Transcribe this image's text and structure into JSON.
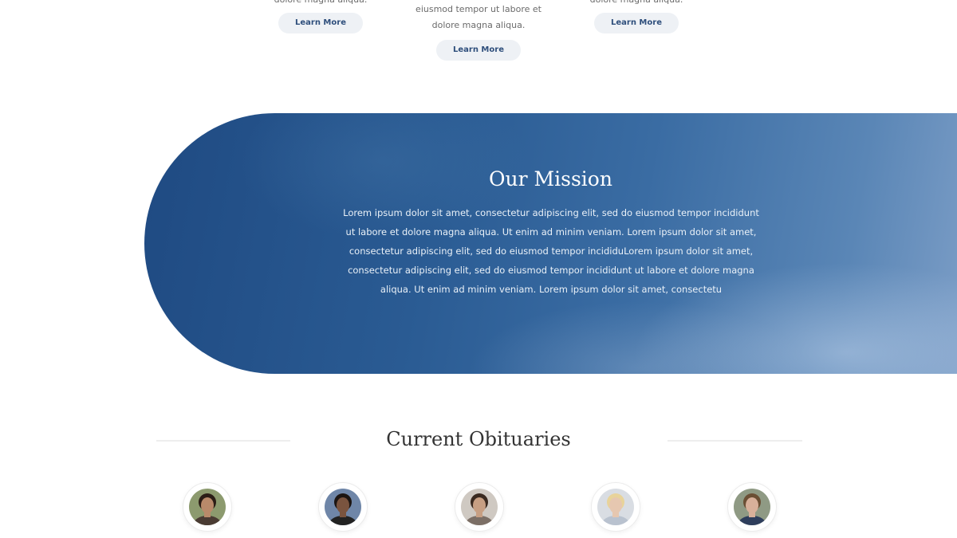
{
  "services": [
    {
      "desc_lines": [
        "dolore magna aliqua."
      ],
      "button_label": "Learn More"
    },
    {
      "desc_lines": [
        "eiusmod tempor ut labore et",
        "dolore magna aliqua."
      ],
      "button_label": "Learn More"
    },
    {
      "desc_lines": [
        "dolore magna aliqua."
      ],
      "button_label": "Learn More"
    }
  ],
  "mission": {
    "title": "Our Mission",
    "text": "Lorem ipsum dolor sit amet, consectetur adipiscing elit, sed do eiusmod tempor incididunt ut labore et dolore magna aliqua. Ut enim ad minim veniam. Lorem ipsum dolor sit amet, consectetur adipiscing elit, sed do eiusmod tempor incididuLorem ipsum dolor sit amet, consectetur adipiscing elit, sed do eiusmod tempor incididunt ut labore et dolore magna aliqua. Ut enim ad minim veniam. Lorem ipsum dolor sit amet, consectetu"
  },
  "obituaries": {
    "title": "Current Obituaries",
    "avatars": [
      {
        "skin": "#b98a6a",
        "hair": "#2b1d16",
        "bg": "#8c9a6e",
        "shirt": "#4a3b33"
      },
      {
        "skin": "#7a543f",
        "hair": "#1c1512",
        "bg": "#6f86a8",
        "shirt": "#222222"
      },
      {
        "skin": "#c79f83",
        "hair": "#3a2a20",
        "bg": "#cfc9c2",
        "shirt": "#7c6f66"
      },
      {
        "skin": "#e6c7b0",
        "hair": "#e8d39a",
        "bg": "#d9dde3",
        "shirt": "#b9c2cf"
      },
      {
        "skin": "#d8b09a",
        "hair": "#6b4f34",
        "bg": "#8f9a84",
        "shirt": "#2e3e5c"
      }
    ]
  }
}
